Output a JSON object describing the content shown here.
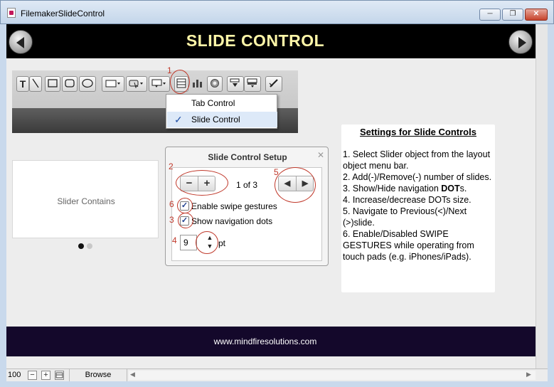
{
  "window": {
    "title": "FilemakerSlideControl",
    "min_glyph": "─",
    "max_glyph": "❐",
    "close_glyph": "✕"
  },
  "header": {
    "title": "SLIDE CONTROL",
    "left_icon": "prev-arrow-circle-icon",
    "right_icon": "next-arrow-circle-icon",
    "title_color": "#fff6a8"
  },
  "toolbar": {
    "text_tool": "T",
    "icons": [
      "text-tool-icon",
      "line-tool-icon",
      "rectangle-tool-icon",
      "rounded-rectangle-tool-icon",
      "oval-tool-icon",
      "field-tool-icon",
      "button-tool-icon",
      "popover-tool-icon",
      "tab-slide-control-icon",
      "chart-tool-icon",
      "web-viewer-icon",
      "portal-tool-icon",
      "field-control-icon",
      "format-painter-icon"
    ]
  },
  "menu": {
    "items": [
      {
        "label": "Tab Control",
        "checked": false
      },
      {
        "label": "Slide Control",
        "checked": true
      }
    ],
    "check_glyph": "✓"
  },
  "slider": {
    "label": "Slider Contains",
    "dots_active_color": "#111111",
    "dots_inactive_color": "#c8c8c8"
  },
  "dialog": {
    "title": "Slide Control Setup",
    "close_glyph": "✕",
    "minus": "−",
    "plus": "+",
    "page_count": "1 of 3",
    "prev_glyph": "◀",
    "next_glyph": "▶",
    "swipe_label": "Enable swipe gestures",
    "swipe_checked": true,
    "dots_label": "Show navigation dots",
    "dots_checked": true,
    "check_glyph": "✓",
    "dot_size": "9",
    "unit": "pt",
    "up_glyph": "▲",
    "down_glyph": "▼"
  },
  "annotations": [
    "1",
    "2",
    "3",
    "4",
    "5",
    "6"
  ],
  "annotation_color": "#c0392b",
  "settings": {
    "title": "Settings for Slide Controls",
    "line1": "1. Select Slider object from the layout object menu bar.",
    "line2": "2. Add(-)/Remove(-) number of slides.",
    "line3_pre": "3. Show/Hide navigation ",
    "line3_bold": "DOT",
    "line3_post": "s.",
    "line4": "4. Increase/decrease DOTs size.",
    "line5": "5. Navigate to Previous(<)/Next (>)slide.",
    "line6": "6. Enable/Disabled SWIPE GESTURES while operating from touch pads (e.g. iPhones/iPads)."
  },
  "footer": {
    "url": "www.mindfiresolutions.com"
  },
  "statusbar": {
    "zoom": "100",
    "zoom_out": "−",
    "zoom_in": "+",
    "mode": "Browse",
    "scroll_left": "◀",
    "scroll_right": "▶"
  }
}
